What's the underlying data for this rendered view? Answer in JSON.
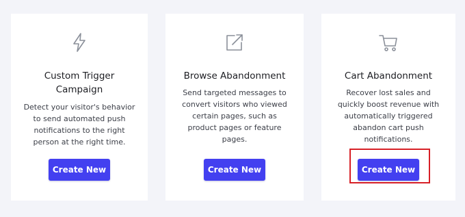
{
  "cards": [
    {
      "icon": "lightning-bolt-icon",
      "title_lines": [
        "Custom Trigger",
        "Campaign"
      ],
      "description_lines": [
        "Detect your visitor's behavior",
        "to send automated push",
        "notifications to the right",
        "person at the right time."
      ],
      "button_label": "Create New"
    },
    {
      "icon": "external-link-icon",
      "title_lines": [
        "Browse Abandonment"
      ],
      "description_lines": [
        "Send targeted messages to",
        "convert visitors who viewed",
        "certain pages, such as",
        "product pages or feature",
        "pages."
      ],
      "button_label": "Create New"
    },
    {
      "icon": "shopping-cart-icon",
      "title_lines": [
        "Cart Abandonment"
      ],
      "description_lines": [
        "Recover lost sales and",
        "quickly boost revenue with",
        "automatically triggered",
        "abandon cart push",
        "notifications."
      ],
      "button_label": "Create New"
    }
  ],
  "colors": {
    "page_background": "#f3f4f9",
    "card_background": "#ffffff",
    "button": "#4340f0",
    "highlight_border": "#d71f26",
    "icon": "#8a8f99"
  }
}
